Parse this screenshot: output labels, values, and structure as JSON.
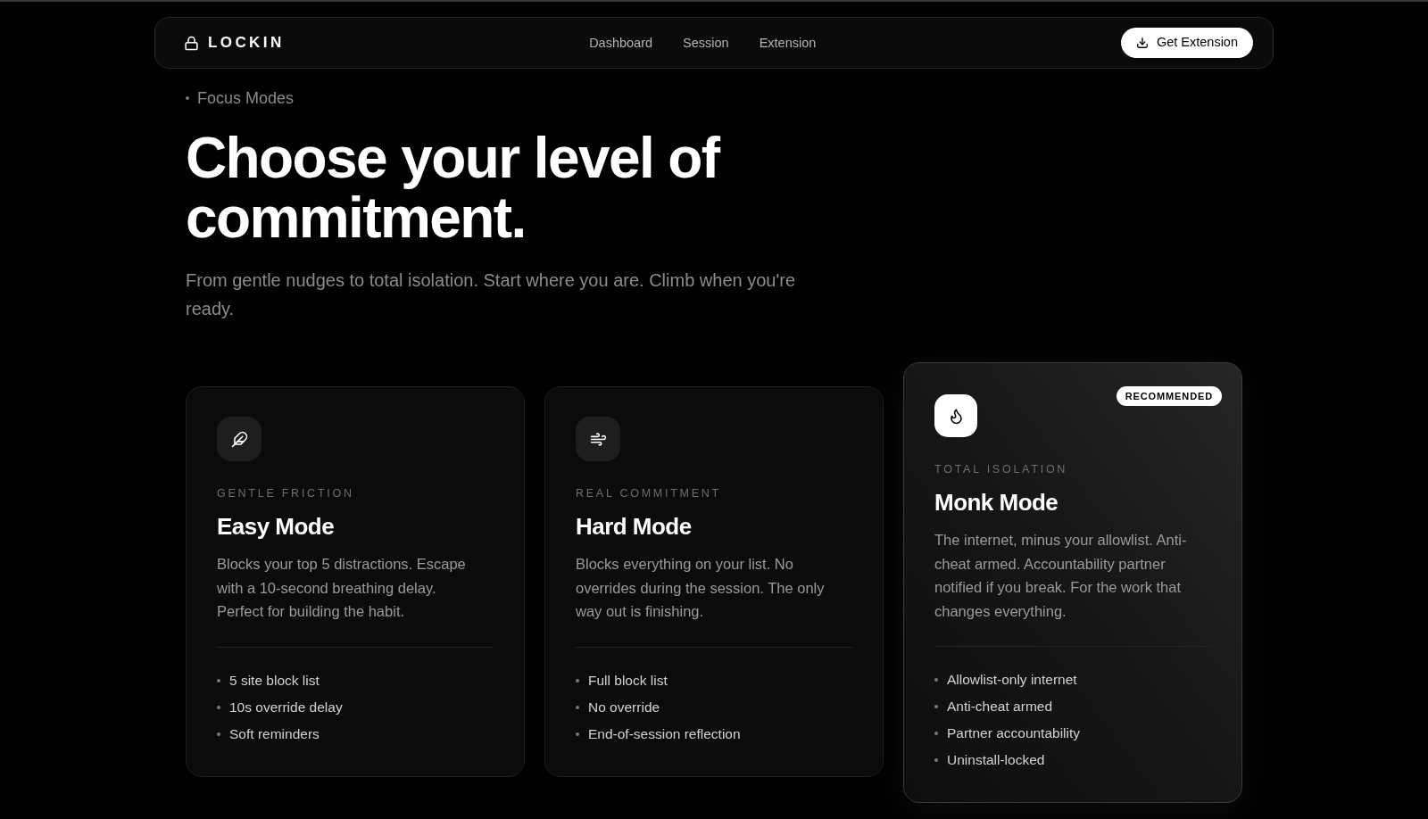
{
  "nav": {
    "brand": "LOCKIN",
    "links": [
      {
        "label": "Dashboard"
      },
      {
        "label": "Session"
      },
      {
        "label": "Extension"
      }
    ],
    "cta": "Get Extension"
  },
  "hero": {
    "eyebrow": "Focus Modes",
    "title": "Choose your level of commitment.",
    "subtitle": "From gentle nudges to total isolation. Start where you are. Climb when you're ready."
  },
  "modes": [
    {
      "tagline": "GENTLE FRICTION",
      "title": "Easy Mode",
      "description": "Blocks your top 5 distractions. Escape with a 10-second breathing delay. Perfect for building the habit.",
      "features": [
        "5 site block list",
        "10s override delay",
        "Soft reminders"
      ],
      "highlighted": false
    },
    {
      "tagline": "REAL COMMITMENT",
      "title": "Hard Mode",
      "description": "Blocks everything on your list. No overrides during the session. The only way out is finishing.",
      "features": [
        "Full block list",
        "No override",
        "End-of-session reflection"
      ],
      "highlighted": false
    },
    {
      "badge": "RECOMMENDED",
      "tagline": "TOTAL ISOLATION",
      "title": "Monk Mode",
      "description": "The internet, minus your allowlist. Anti-cheat armed. Accountability partner notified if you break. For the work that changes everything.",
      "features": [
        "Allowlist-only internet",
        "Anti-cheat armed",
        "Partner accountability",
        "Uninstall-locked"
      ],
      "highlighted": true
    }
  ]
}
